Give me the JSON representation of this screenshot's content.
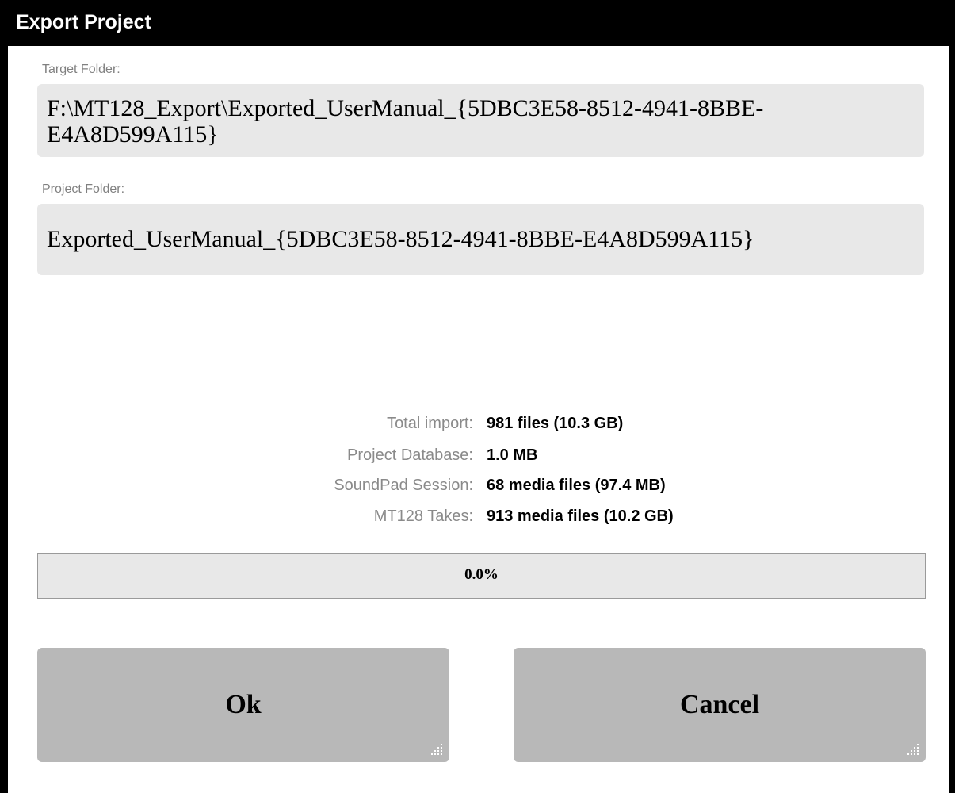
{
  "window": {
    "title": "Export Project"
  },
  "target_folder": {
    "label": "Target Folder:",
    "line1": "F:\\MT128_Export\\Exported_UserManual_{5DBC3E58-8512-4941-8BBE-",
    "line2": "E4A8D599A115}"
  },
  "project_folder": {
    "label": "Project Folder:",
    "value": "Exported_UserManual_{5DBC3E58-8512-4941-8BBE-E4A8D599A115}"
  },
  "stats": [
    {
      "label": "Total import:",
      "value": "981 files (10.3 GB)"
    },
    {
      "label": "Project Database:",
      "value": "1.0 MB"
    },
    {
      "label": "SoundPad Session:",
      "value": "68 media files (97.4 MB)"
    },
    {
      "label": "MT128 Takes:",
      "value": "913 media files (10.2 GB)"
    }
  ],
  "progress": {
    "text": "0.0%",
    "fraction": 0.0
  },
  "buttons": {
    "ok": "Ok",
    "cancel": "Cancel"
  },
  "icons": {
    "resize_grip": "resize-grip-icon"
  },
  "colors": {
    "title_bar": "#000000",
    "field_bg": "#e8e8e8",
    "button_bg": "#b8b8b8",
    "label_gray": "#808080"
  }
}
